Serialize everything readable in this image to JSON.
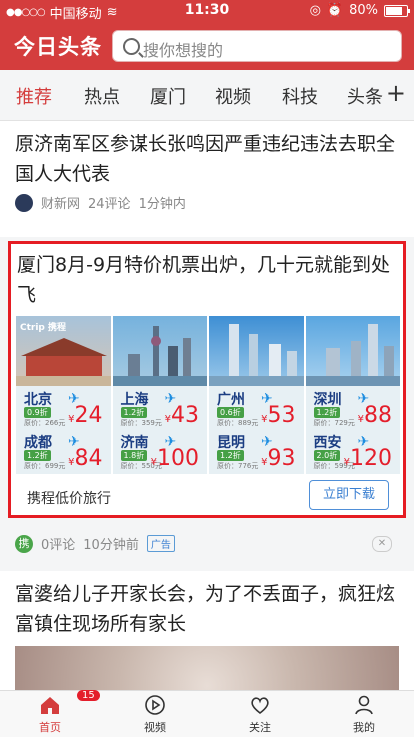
{
  "status": {
    "carrier": "中国移动",
    "time": "11:30",
    "battery": "80%"
  },
  "header": {
    "logo": "今日头条",
    "search_placeholder": "搜你想搜的"
  },
  "tabs": [
    "推荐",
    "热点",
    "厦门",
    "视频",
    "科技",
    "头条"
  ],
  "feed": {
    "item1": {
      "title": "原济南军区参谋长张鸣因严重违纪违法去职全国人大代表",
      "source": "财新网",
      "comments": "24评论",
      "time": "1分钟内"
    },
    "ad": {
      "title": "厦门8月-9月特价机票出炉，几十元就能到处飞",
      "tiles": [
        {
          "brand": "Ctrip 携程",
          "rows": [
            {
              "city": "北京",
              "discount": "0.9折",
              "orig": "原价：266元",
              "price": "24"
            },
            {
              "city": "成都",
              "discount": "1.2折",
              "orig": "原价：699元",
              "price": "84"
            }
          ]
        },
        {
          "brand": "",
          "rows": [
            {
              "city": "上海",
              "discount": "1.2折",
              "orig": "原价：359元",
              "price": "43"
            },
            {
              "city": "济南",
              "discount": "1.8折",
              "orig": "原价：550元",
              "price": "100"
            }
          ]
        },
        {
          "brand": "",
          "rows": [
            {
              "city": "广州",
              "discount": "0.6折",
              "orig": "原价：889元",
              "price": "53"
            },
            {
              "city": "昆明",
              "discount": "1.2折",
              "orig": "原价：776元",
              "price": "93"
            }
          ]
        },
        {
          "brand": "",
          "rows": [
            {
              "city": "深圳",
              "discount": "1.2折",
              "orig": "原价：729元",
              "price": "88"
            },
            {
              "city": "西安",
              "discount": "2.0折",
              "orig": "原价：599元",
              "price": "120"
            }
          ]
        }
      ],
      "brand_name": "携程低价旅行",
      "download_label": "立即下载",
      "meta_icon": "携",
      "comments": "0评论",
      "time": "10分钟前",
      "ad_tag": "广告",
      "close": "✕"
    },
    "item3": {
      "title": "富婆给儿子开家长会，为了不丢面子，疯狂炫富镇住现场所有家长"
    }
  },
  "bottom_nav": [
    {
      "label": "首页",
      "badge": "15"
    },
    {
      "label": "视频"
    },
    {
      "label": "关注"
    },
    {
      "label": "我的"
    }
  ],
  "colors": {
    "brand_red": "#d43d3d",
    "ad_border": "#e51c23",
    "price_red": "#e41e2b",
    "link_blue": "#3a7fd1"
  },
  "icons": {
    "search": "search-icon",
    "plane": "plane-icon",
    "home": "home-icon",
    "video": "play-icon",
    "follow": "heart-icon",
    "me": "person-icon",
    "add_tab": "plus-icon"
  }
}
